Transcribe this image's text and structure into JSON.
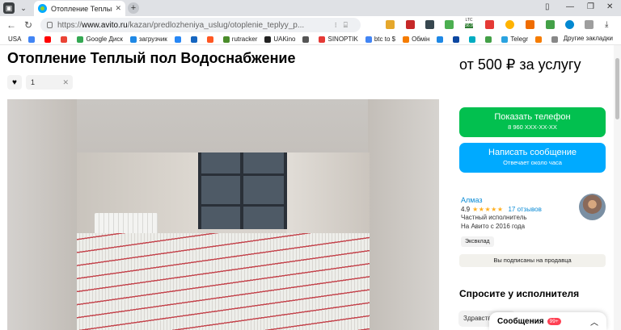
{
  "browser": {
    "tab": {
      "title": "Отопление Теплый пол",
      "close": "✕"
    },
    "new_tab": "+",
    "url": {
      "scheme": "https://",
      "host": "www.avito.ru",
      "path": "/kazan/predlozheniya_uslug/otoplenie_teplyy_p..."
    },
    "window_controls": [
      "—",
      "❐",
      "✕"
    ],
    "extension_labels": {
      "ltc": "LTC",
      "ltc_value": "56.9"
    }
  },
  "bookmarks": {
    "items": [
      {
        "label": "USA",
        "color": "#ffffff"
      },
      {
        "label": "",
        "color": "#4285f4"
      },
      {
        "label": "",
        "color": "#ff0000"
      },
      {
        "label": "",
        "color": "#ea4335"
      },
      {
        "label": "Google Диск",
        "color": "#34a853"
      },
      {
        "label": "загрузчик",
        "color": "#1e88e5"
      },
      {
        "label": "",
        "color": "#2787f5"
      },
      {
        "label": "",
        "color": "#1565c0"
      },
      {
        "label": "",
        "color": "#ff5722"
      },
      {
        "label": "rutracker",
        "color": "#4a8c2a"
      },
      {
        "label": "UAKino",
        "color": "#222222"
      },
      {
        "label": "",
        "color": "#555555"
      },
      {
        "label": "SINOPTIK",
        "color": "#e53935"
      },
      {
        "label": "btc to $",
        "color": "#4285f4"
      },
      {
        "label": "Обмін",
        "color": "#f57c00"
      },
      {
        "label": "",
        "color": "#1e88e5"
      },
      {
        "label": "",
        "color": "#0d47a1"
      },
      {
        "label": "",
        "color": "#00acc1"
      },
      {
        "label": "",
        "color": "#43a047"
      },
      {
        "label": "Telegr",
        "color": "#2aa3e0"
      },
      {
        "label": "",
        "color": "#f57c00"
      },
      {
        "label": "",
        "color": "#888888"
      }
    ],
    "other": "Другие закладки"
  },
  "page": {
    "title": "Отопление Теплый пол Водоснабжение",
    "favorites_count": "1",
    "price": "от 500 ₽ за услугу",
    "call_button": {
      "label": "Показать телефон",
      "sub": "8 960 XXX-XX-XX"
    },
    "message_button": {
      "label": "Написать сообщение",
      "sub": "Отвечает около часа"
    },
    "seller": {
      "name": "Алмаз",
      "rating": "4.9",
      "stars": "★★★★★",
      "reviews": "17 отзывов",
      "type": "Частный исполнитель",
      "since": "На Авито с 2016 года",
      "tag": "Эксвклад",
      "subscribed": "Вы подписаны на продавца"
    },
    "ask": {
      "title": "Спросите у исполнителя",
      "input_value": "Здравствуйте"
    },
    "messages": {
      "label": "Сообщения",
      "badge": "99+"
    }
  },
  "colors": {
    "green": "#02c04f",
    "blue": "#00aaff",
    "link": "#0a8bd6",
    "star": "#ffb021",
    "badge": "#ff4053"
  }
}
